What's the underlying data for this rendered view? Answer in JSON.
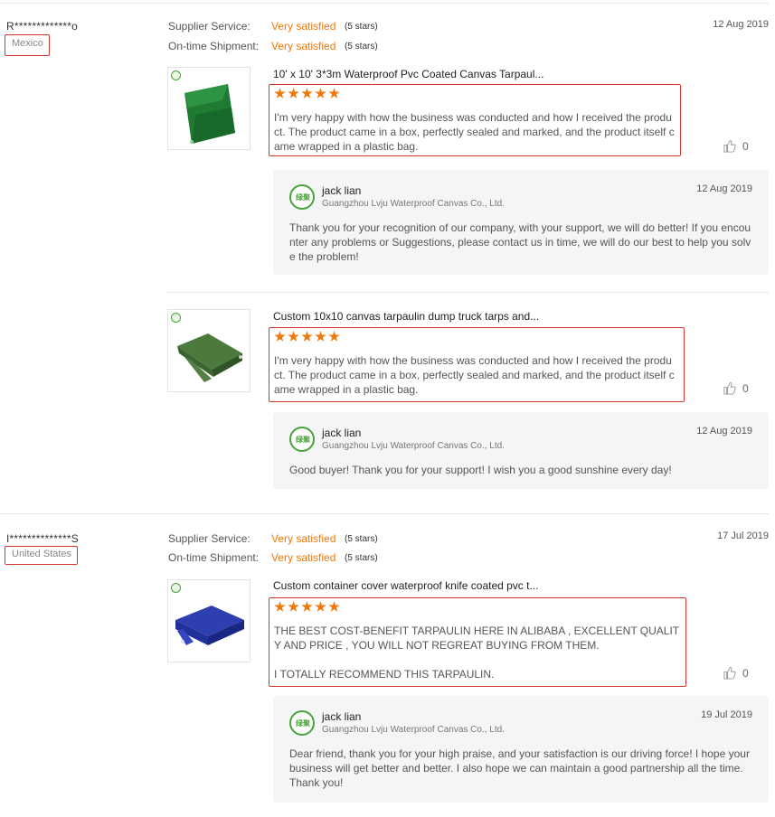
{
  "accent_color": "#f07808",
  "highlight_color": "#d9352e",
  "reviews": [
    {
      "buyer": "R*************o",
      "country": "Mexico",
      "supplier_service_label": "Supplier Service:",
      "supplier_service_value": "Very satisfied",
      "supplier_service_stars": "(5 stars)",
      "shipment_label": "On-time Shipment:",
      "shipment_value": "Very satisfied",
      "shipment_stars": "(5 stars)",
      "date": "12 Aug 2019",
      "items": [
        {
          "product_title": "10' x 10' 3*3m Waterproof Pvc Coated Canvas Tarpaul...",
          "product_color": "green",
          "star_rating": 5,
          "text": "I'm very happy with how the business was conducted and how I received the product. The product came in a box, perfectly sealed and marked, and the product itself came wrapped in a plastic bag.",
          "helpful_count": "0",
          "reply": {
            "name": "jack lian",
            "company": "Guangzhou Lvju Waterproof Canvas Co., Ltd.",
            "date": "12 Aug 2019",
            "text": "Thank you for your recognition of our company, with your support, we will do better! If you encounter any problems or Suggestions, please contact us in time, we will do our best to help you solve the problem!"
          }
        },
        {
          "product_title": "Custom 10x10 canvas tarpaulin dump truck tarps and...",
          "product_color": "olive",
          "star_rating": 5,
          "text": "I'm very happy with how the business was conducted and how I received the product. The product came in a box, perfectly sealed and marked, and the product itself came wrapped in a plastic bag.",
          "helpful_count": "0",
          "reply": {
            "name": "jack lian",
            "company": "Guangzhou Lvju Waterproof Canvas Co., Ltd.",
            "date": "12 Aug 2019",
            "text": "Good buyer! Thank you for your support! I wish you a good sunshine every day!"
          }
        }
      ]
    },
    {
      "buyer": "I**************S",
      "country": "United States",
      "supplier_service_label": "Supplier Service:",
      "supplier_service_value": "Very satisfied",
      "supplier_service_stars": "(5 stars)",
      "shipment_label": "On-time Shipment:",
      "shipment_value": "Very satisfied",
      "shipment_stars": "(5 stars)",
      "date": "17 Jul 2019",
      "items": [
        {
          "product_title": "Custom container cover waterproof knife coated pvc t...",
          "product_color": "blue",
          "star_rating": 5,
          "text": "THE BEST COST-BENEFIT TARPAULIN HERE IN ALIBABA , EXCELLENT QUALITY AND PRICE ,  YOU WILL NOT REGREAT BUYING FROM THEM.\n\nI TOTALLY RECOMMEND THIS TARPAULIN.",
          "helpful_count": "0",
          "reply": {
            "name": "jack lian",
            "company": "Guangzhou Lvju Waterproof Canvas Co., Ltd.",
            "date": "19 Jul 2019",
            "text": "Dear friend, thank you for your high praise, and your satisfaction is our driving force! I hope your business will get better and better. I also hope we can maintain a good partnership all the time. Thank you!"
          }
        }
      ]
    }
  ],
  "icons": {
    "helpful": "thumbs-up-icon",
    "supplier_logo": "lvju-logo",
    "verified_badge": "green-badge-icon"
  }
}
